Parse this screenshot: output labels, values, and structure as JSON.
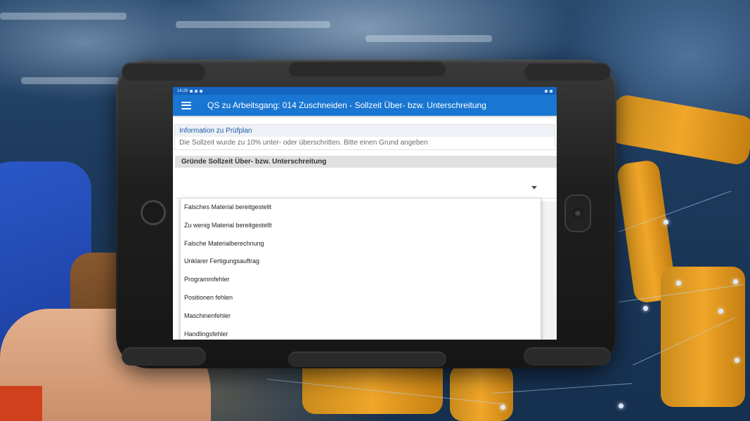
{
  "statusbar": {
    "time": "14:28"
  },
  "appbar": {
    "title": "QS zu Arbeitsgang: 014 Zuschneiden - Sollzeit Über- bzw. Unterschreitung"
  },
  "info": {
    "title": "Information zu Prüfplan",
    "text": "Die Sollzeit wurde zu 10% unter- oder überschritten. Bitte einen Grund angeben"
  },
  "reasons": {
    "header": "Gründe Sollzeit Über- bzw. Unterschreitung",
    "selected_value": "",
    "options": [
      "Falsches Material bereitgestellt",
      "Zu wenig Material bereitgestellt",
      "Falsche Materialberechnung",
      "Unklarer Fertigungsauftrag",
      "Programmfehler",
      "Positionen fehlen",
      "Maschinenfehler",
      "Handlingsfehler"
    ]
  },
  "colors": {
    "appbar": "#1976d2",
    "statusbar": "#1565c0",
    "info_title": "#1e5aa8"
  },
  "icons": [
    "menu-icon",
    "chevron-down-icon"
  ]
}
